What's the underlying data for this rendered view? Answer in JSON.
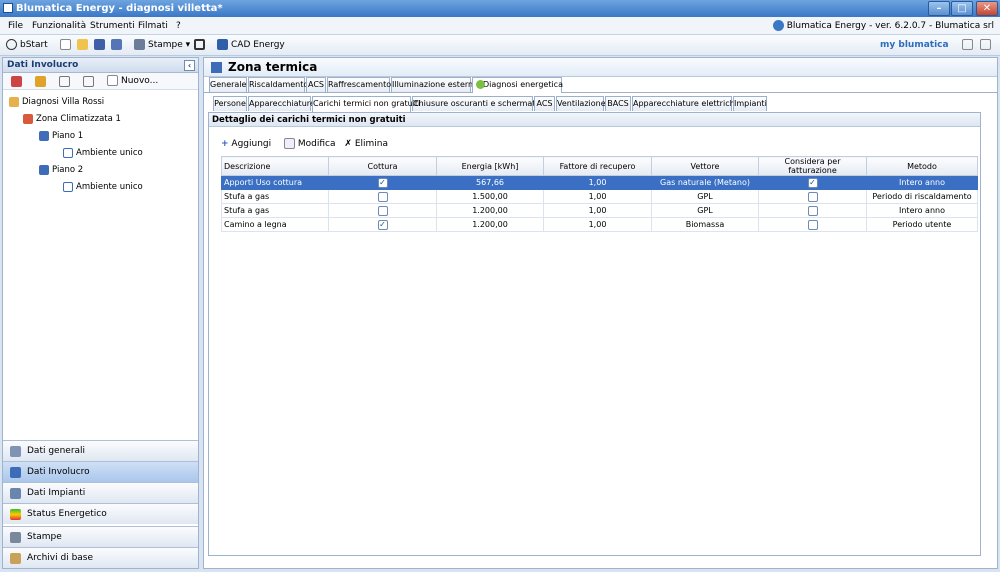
{
  "window": {
    "title": "Blumatica Energy - diagnosi villetta*"
  },
  "menu": {
    "items": [
      "File",
      "Funzionalità",
      "Strumenti",
      "Filmati",
      "?"
    ],
    "version": "Blumatica Energy - ver. 6.2.0.7 - Blumatica srl"
  },
  "toolbar": {
    "bstart": "bStart",
    "stampe": "Stampe",
    "cad": "CAD Energy",
    "brand": "my blumatica"
  },
  "left": {
    "header": "Dati Involucro",
    "nuovo": "Nuovo...",
    "tree": [
      "Diagnosi Villa Rossi",
      "Zona Climatizzata 1",
      "Piano 1",
      "Ambiente unico",
      "Piano 2",
      "Ambiente unico"
    ],
    "nav": [
      "Dati generali",
      "Dati Involucro",
      "Dati Impianti",
      "Status Energetico",
      "Stampe",
      "Archivi di base"
    ]
  },
  "main": {
    "title": "Zona termica",
    "tabs1": [
      "Generale",
      "Riscaldamento",
      "ACS",
      "Raffrescamento",
      "Illuminazione esterna",
      "Diagnosi energetica"
    ],
    "tabs2": [
      "Persone",
      "Apparecchiature",
      "Carichi termici non gratuiti",
      "Chiusure oscuranti e schermature",
      "ACS",
      "Ventilazione",
      "BACS",
      "Apparecchiature elettriche",
      "Impianti"
    ],
    "section": "Dettaglio dei carichi termici non gratuiti",
    "actions": [
      "Aggiungi",
      "Modifica",
      "Elimina"
    ],
    "columns": [
      "Descrizione",
      "Cottura",
      "Energia [kWh]",
      "Fattore di recupero",
      "Vettore",
      "Considera per fatturazione",
      "Metodo"
    ],
    "rows": [
      {
        "descrizione": "Apporti Uso cottura",
        "cottura": true,
        "energia": "567,66",
        "fattore": "1,00",
        "vettore": "Gas naturale (Metano)",
        "fatt": true,
        "metodo": "Intero anno"
      },
      {
        "descrizione": "Stufa a gas",
        "cottura": false,
        "energia": "1.500,00",
        "fattore": "1,00",
        "vettore": "GPL",
        "fatt": false,
        "metodo": "Periodo di riscaldamento"
      },
      {
        "descrizione": "Stufa a gas",
        "cottura": false,
        "energia": "1.200,00",
        "fattore": "1,00",
        "vettore": "GPL",
        "fatt": false,
        "metodo": "Intero anno"
      },
      {
        "descrizione": "Camino a legna",
        "cottura": true,
        "energia": "1.200,00",
        "fattore": "1,00",
        "vettore": "Biomassa",
        "fatt": false,
        "metodo": "Periodo utente"
      }
    ]
  }
}
